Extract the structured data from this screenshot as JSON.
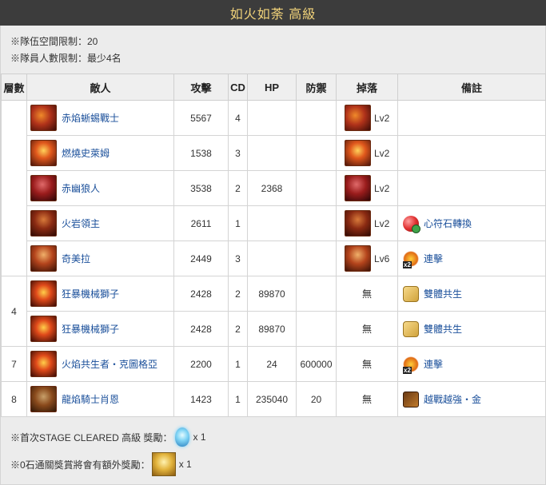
{
  "title": "如火如荼 高級",
  "notes": {
    "team_limit": "※隊伍空間限制：20",
    "member_limit": "※隊員人數限制：最少4名"
  },
  "headers": [
    "層數",
    "敵人",
    "攻擊",
    "CD",
    "HP",
    "防禦",
    "掉落",
    "備註"
  ],
  "rows": [
    {
      "enemy": "赤焰蜥蜴戰士",
      "atk": "5567",
      "cd": "4",
      "hp": "",
      "def": "",
      "drop": "Lv2",
      "note": ""
    },
    {
      "enemy": "燃燒史萊姆",
      "atk": "1538",
      "cd": "3",
      "hp": "",
      "def": "",
      "drop": "Lv2",
      "note": ""
    },
    {
      "enemy": "赤幽狼人",
      "atk": "3538",
      "cd": "2",
      "hp": "2368",
      "def": "",
      "drop": "Lv2",
      "note": ""
    },
    {
      "enemy": "火岩領主",
      "atk": "2611",
      "cd": "1",
      "hp": "",
      "def": "",
      "drop": "Lv2",
      "note": "心符石轉換"
    },
    {
      "enemy": "奇美拉",
      "atk": "2449",
      "cd": "3",
      "hp": "",
      "def": "",
      "drop": "Lv6",
      "note": "連擊"
    },
    {
      "floor": "4",
      "enemy": "狂暴機械獅子",
      "atk": "2428",
      "cd": "2",
      "hp": "89870",
      "def": "",
      "drop": "無",
      "note": "雙體共生"
    },
    {
      "enemy": "狂暴機械獅子",
      "atk": "2428",
      "cd": "2",
      "hp": "89870",
      "def": "",
      "drop": "無",
      "note": "雙體共生"
    },
    {
      "floor": "7",
      "enemy": "火焰共生者‧克圖格亞",
      "atk": "2200",
      "cd": "1",
      "hp": "24",
      "def": "600000",
      "drop": "無",
      "note": "連擊"
    },
    {
      "floor": "8",
      "enemy": "龍焰騎士肖恩",
      "atk": "1423",
      "cd": "1",
      "hp": "235040",
      "def": "20",
      "drop": "無",
      "note": "越戰越強‧金"
    }
  ],
  "rewards": {
    "first_clear": "※首次STAGE CLEARED 高級 獎勵：",
    "first_clear_qty": "x 1",
    "zero_stone": "※0石通關獎賞將會有額外獎勵：",
    "zero_stone_qty": "x 1"
  },
  "icons": {
    "enemy_portraits": [
      "fire-lizard-warrior-icon",
      "burning-slime-icon",
      "red-werewolf-icon",
      "fire-rock-lord-icon",
      "chimera-icon",
      "berserk-mech-lion-icon",
      "berserk-mech-lion-icon",
      "cthugha-icon",
      "dragon-knight-sean-icon"
    ],
    "skills": {
      "心符石轉換": "heart-stone-convert-icon",
      "連擊": "combo-x2-icon",
      "雙體共生": "twin-symbiosis-icon",
      "越戰越強‧金": "stronger-gold-icon"
    },
    "reward_1": "crystal-icon",
    "reward_2": "gold-card-icon"
  },
  "colors": {
    "title_bg": "#3c3c3c",
    "title_text": "#f2d37a",
    "link": "#1a4f9a"
  }
}
